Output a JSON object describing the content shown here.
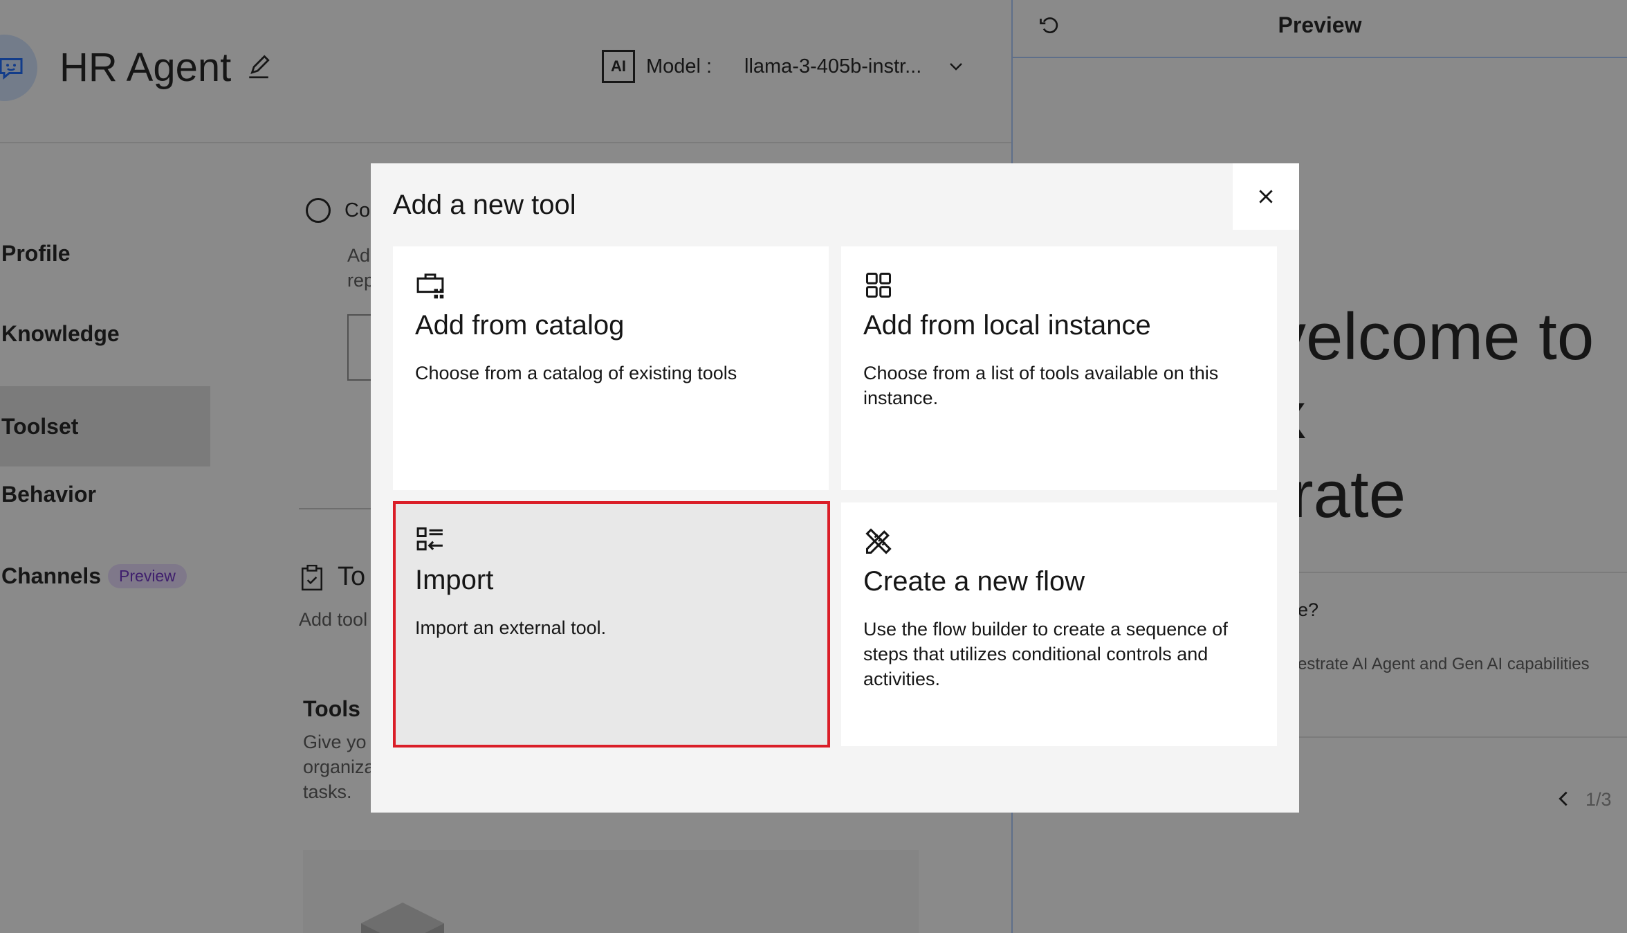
{
  "header": {
    "agent_name": "HR Agent",
    "model_badge": "AI",
    "model_label": "Model :",
    "model_value": "llama-3-405b-instr..."
  },
  "sidebar": {
    "items": [
      {
        "label": "Profile"
      },
      {
        "label": "Knowledge"
      },
      {
        "label": "Toolset"
      },
      {
        "label": "Behavior"
      },
      {
        "label": "Channels",
        "tag": "Preview"
      }
    ]
  },
  "content": {
    "radio_label": "Co",
    "desc_line1": "Ad",
    "desc_line2": "rep",
    "toolset_header": "To",
    "toolset_sub": "Add tool",
    "tools_heading": "Tools",
    "tools_desc_1": "Give yo",
    "tools_desc_2": "organiza",
    "tools_desc_3": "tasks."
  },
  "preview": {
    "title": "Preview",
    "welcome_line1": "velcome to",
    "welcome_line2": "x",
    "welcome_line3": "trate",
    "faq_question": "e?",
    "faq_answer": "estrate AI Agent and Gen AI capabilities",
    "pager": "1/3"
  },
  "modal": {
    "title": "Add a new tool",
    "tiles": [
      {
        "icon": "catalog-icon",
        "title": "Add from catalog",
        "desc": "Choose from a catalog of existing tools"
      },
      {
        "icon": "grid-icon",
        "title": "Add from local instance",
        "desc": "Choose from a list of tools available on this instance."
      },
      {
        "icon": "import-icon",
        "title": "Import",
        "desc": "Import an external tool.",
        "selected": true
      },
      {
        "icon": "flow-tools-icon",
        "title": "Create a new flow",
        "desc": "Use the flow builder to create a sequence of steps that utilizes conditional controls and activities."
      }
    ]
  },
  "colors": {
    "accent": "#0f62fe",
    "selected_border": "#da1e28",
    "tag_bg": "#e8daff",
    "tag_text": "#6929c4"
  }
}
